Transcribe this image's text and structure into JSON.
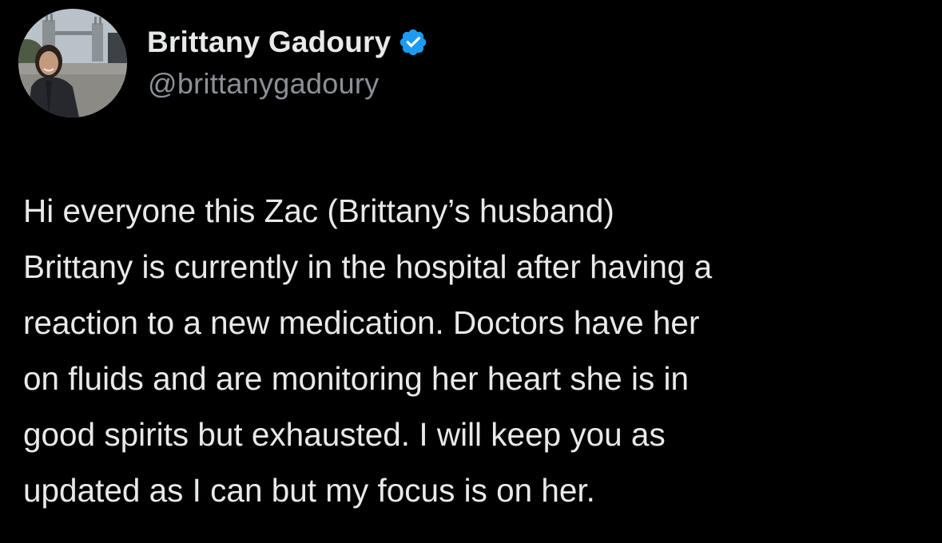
{
  "author": {
    "display_name": "Brittany Gadoury",
    "handle": "@brittanygadoury",
    "verified": true,
    "verified_icon": "verified-badge-icon",
    "verified_color": "#1d9bf0"
  },
  "tweet": {
    "lines": [
      "Hi everyone this Zac (Brittany’s husband)",
      "Brittany is currently in the hospital after having a",
      "reaction to a new medication. Doctors have her",
      "on fluids and are monitoring her heart she is in",
      "good spirits but exhausted. I will keep you as",
      "updated as I can but my focus is on her."
    ]
  },
  "theme": {
    "background": "#000000",
    "text": "#e7e9ea",
    "secondary_text": "#8b9197"
  }
}
